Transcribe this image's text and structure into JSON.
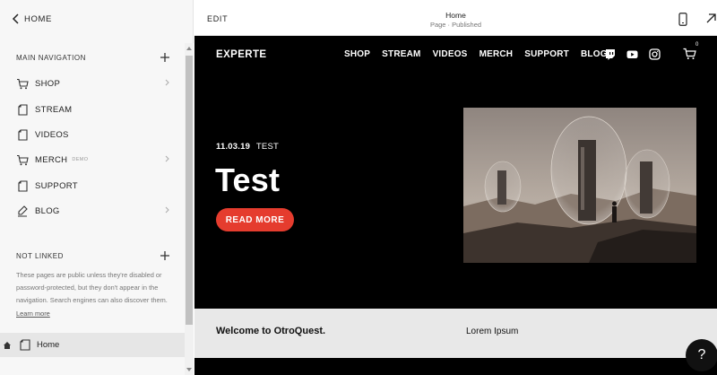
{
  "sidebar": {
    "back_label": "HOME",
    "main_nav_title": "MAIN NAVIGATION",
    "items": [
      {
        "label": "SHOP",
        "icon": "cart-icon",
        "has_arrow": true
      },
      {
        "label": "STREAM",
        "icon": "page-icon",
        "has_arrow": false
      },
      {
        "label": "VIDEOS",
        "icon": "page-icon",
        "has_arrow": false
      },
      {
        "label": "MERCH",
        "badge": "DEMO",
        "icon": "cart-icon",
        "has_arrow": true
      },
      {
        "label": "SUPPORT",
        "icon": "page-icon",
        "has_arrow": false
      },
      {
        "label": "BLOG",
        "icon": "blog-icon",
        "has_arrow": true
      }
    ],
    "not_linked_title": "NOT LINKED",
    "not_linked_desc": "These pages are public unless they're disabled or password-protected, but they don't appear in the navigation. Search engines can also discover them.",
    "learn_more": "Learn more",
    "home_page_label": "Home"
  },
  "topbar": {
    "edit_label": "EDIT",
    "page_title": "Home",
    "page_status": "Page · Published"
  },
  "site": {
    "brand": "EXPERTE",
    "nav": [
      "SHOP",
      "STREAM",
      "VIDEOS",
      "MERCH",
      "SUPPORT",
      "BLOG"
    ],
    "social_icons": [
      "twitch-icon",
      "youtube-icon",
      "instagram-icon"
    ],
    "cart_count": "0",
    "post_date": "11.03.19",
    "post_category": "TEST",
    "post_title": "Test",
    "cta_label": "READ MORE",
    "welcome_heading": "Welcome to OtroQuest.",
    "lorem_heading": "Lorem Ipsum"
  },
  "help_label": "?",
  "colors": {
    "accent_red": "#e53c2e",
    "preview_bg": "#000000",
    "sidebar_bg": "#f7f7f7"
  }
}
